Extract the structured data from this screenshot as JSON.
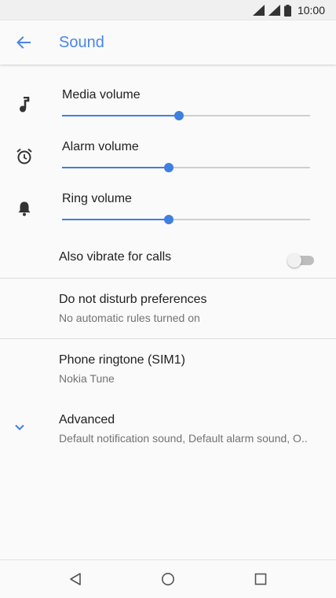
{
  "status_bar": {
    "time": "10:00"
  },
  "app_bar": {
    "title": "Sound",
    "back_icon": "arrow-back-icon"
  },
  "volumes": [
    {
      "label": "Media volume",
      "icon": "music-note-icon",
      "level": 0.47
    },
    {
      "label": "Alarm volume",
      "icon": "alarm-clock-icon",
      "level": 0.43
    },
    {
      "label": "Ring volume",
      "icon": "bell-icon",
      "level": 0.43
    }
  ],
  "vibrate": {
    "label": "Also vibrate for calls",
    "on": false
  },
  "dnd": {
    "title": "Do not disturb preferences",
    "subtitle": "No automatic rules turned on"
  },
  "ringtone": {
    "title": "Phone ringtone (SIM1)",
    "subtitle": "Nokia Tune"
  },
  "advanced": {
    "title": "Advanced",
    "subtitle": "Default notification sound, Default alarm sound, O..",
    "icon": "chevron-down-icon"
  },
  "colors": {
    "accent": "#3f7fe0",
    "title": "#4a86e8"
  }
}
